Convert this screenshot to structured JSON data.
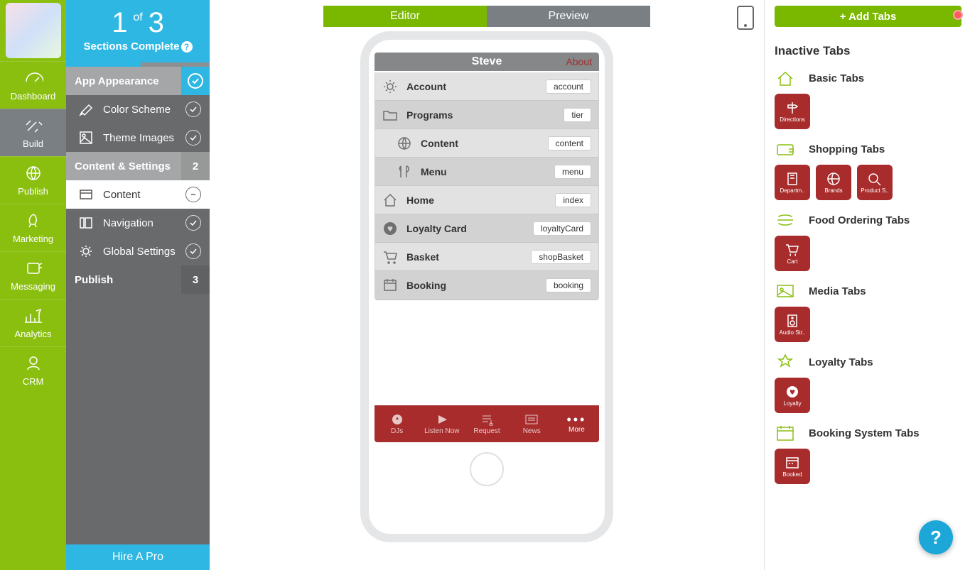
{
  "leftnav": {
    "items": [
      {
        "label": "Dashboard"
      },
      {
        "label": "Build"
      },
      {
        "label": "Publish"
      },
      {
        "label": "Marketing"
      },
      {
        "label": "Messaging"
      },
      {
        "label": "Analytics"
      },
      {
        "label": "CRM"
      }
    ]
  },
  "progress": {
    "done": "1",
    "of_word": "of",
    "total": "3",
    "label": "Sections Complete"
  },
  "sections": {
    "app_appearance": "App Appearance",
    "color_scheme": "Color Scheme",
    "theme_images": "Theme Images",
    "content_settings": "Content & Settings",
    "content_settings_badge": "2",
    "content": "Content",
    "navigation": "Navigation",
    "global_settings": "Global Settings",
    "publish": "Publish",
    "publish_badge": "3"
  },
  "hire_label": "Hire A Pro",
  "topbar": {
    "editor": "Editor",
    "preview": "Preview"
  },
  "phone": {
    "title": "Steve",
    "about": "About",
    "rows": [
      {
        "name": "Account",
        "tag": "account"
      },
      {
        "name": "Programs",
        "tag": "tier"
      },
      {
        "name": "Content",
        "tag": "content"
      },
      {
        "name": "Menu",
        "tag": "menu"
      },
      {
        "name": "Home",
        "tag": "index"
      },
      {
        "name": "Loyalty Card",
        "tag": "loyaltyCard"
      },
      {
        "name": "Basket",
        "tag": "shopBasket"
      },
      {
        "name": "Booking",
        "tag": "booking"
      }
    ],
    "tabbar": [
      "DJs",
      "Listen Now",
      "Request",
      "News",
      "More"
    ]
  },
  "right": {
    "add_tabs": "+ Add Tabs",
    "heading": "Inactive Tabs",
    "groups": [
      {
        "label": "Basic Tabs",
        "tiles": [
          "Directions"
        ]
      },
      {
        "label": "Shopping Tabs",
        "tiles": [
          "Departm..",
          "Brands",
          "Product S.."
        ]
      },
      {
        "label": "Food Ordering Tabs",
        "tiles": [
          "Cart"
        ]
      },
      {
        "label": "Media Tabs",
        "tiles": [
          "Audio Str.."
        ]
      },
      {
        "label": "Loyalty Tabs",
        "tiles": [
          "Loyalty"
        ]
      },
      {
        "label": "Booking System Tabs",
        "tiles": [
          "Booked"
        ]
      }
    ]
  }
}
